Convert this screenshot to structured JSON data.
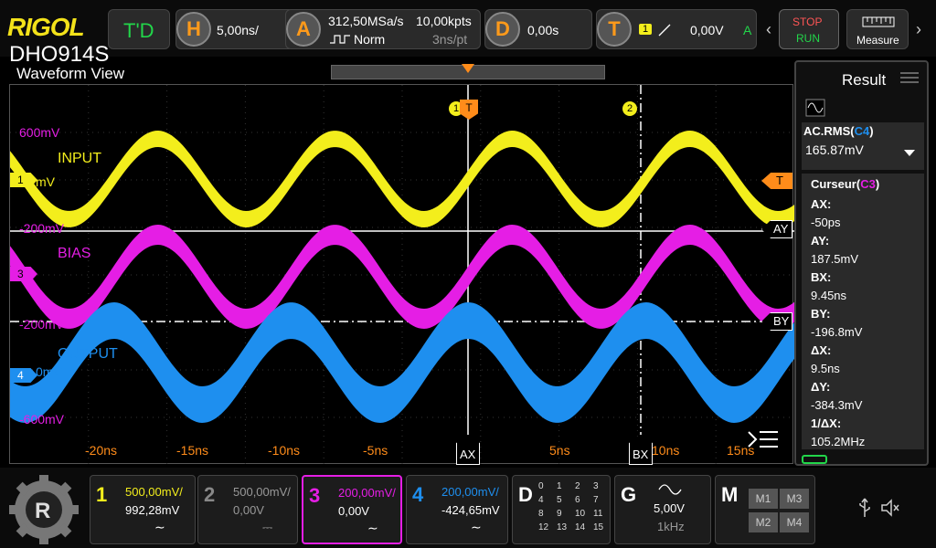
{
  "header": {
    "logo": "RIGOL",
    "model": "DHO914S",
    "td": "T'D",
    "h_letter": "H",
    "timebase": "5,00ns/",
    "a_letter": "A",
    "sample_rate": "312,50MSa/s",
    "memory_depth": "10,00kpts",
    "acq_mode": "Norm",
    "points_time": "3ns/pt",
    "d_letter": "D",
    "delay": "0,00s",
    "t_letter": "T",
    "trig_channel": "1",
    "trig_level": "0,00V",
    "trig_mode": "A",
    "stop_label": "STOP",
    "run_label": "RUN",
    "measure_label": "Measure"
  },
  "view": {
    "title": "Waveform View"
  },
  "screen": {
    "labels": {
      "v600": "600mV",
      "c1off": "mV",
      "v200": "-200mV",
      "c3off": "-200mV",
      "c4off": "0mV",
      "vm600": "-600mV",
      "input": "INPUT",
      "bias": "BIAS",
      "output": "OUTPUT"
    },
    "markers": {
      "ch1": "1",
      "ch3": "3",
      "ch4": "4",
      "trig": "T",
      "ay": "AY",
      "by": "BY",
      "ax": "AX",
      "bx": "BX",
      "mk1": "1",
      "mk2": "2"
    },
    "xticks": [
      "-20ns",
      "-15ns",
      "-10ns",
      "-5ns",
      "5ns",
      "10ns",
      "15ns"
    ]
  },
  "result": {
    "title": "Result",
    "meas_name": "AC.RMS(",
    "meas_src": "C4",
    "meas_close": ")",
    "meas_value": "165.87mV",
    "cursor_title": "Curseur(",
    "cursor_src": "C3",
    "cursor_close": ")",
    "items": [
      {
        "k": "AX:",
        "v": "-50ps"
      },
      {
        "k": "AY:",
        "v": "187.5mV"
      },
      {
        "k": "BX:",
        "v": "9.45ns"
      },
      {
        "k": "BY:",
        "v": "-196.8mV"
      },
      {
        "k": "ΔX:",
        "v": "9.5ns"
      },
      {
        "k": "ΔY:",
        "v": "-384.3mV"
      },
      {
        "k": "1/ΔX:",
        "v": "105.2MHz"
      }
    ]
  },
  "channels": [
    {
      "num": "1",
      "scale": "500,00mV/",
      "offset": "992,28mV",
      "coupling": "∼",
      "color": "#f3ee1c"
    },
    {
      "num": "2",
      "scale": "500,00mV/",
      "offset": "0,00V",
      "coupling": "⎓",
      "color": "#888888"
    },
    {
      "num": "3",
      "scale": "200,00mV/",
      "offset": "0,00V",
      "coupling": "∼",
      "color": "#e51ee5"
    },
    {
      "num": "4",
      "scale": "200,00mV/",
      "offset": "-424,65mV",
      "coupling": "∼",
      "color": "#1e8fef"
    }
  ],
  "digital": {
    "letter": "D",
    "rows": [
      [
        "0",
        "1",
        "2",
        "3"
      ],
      [
        "4",
        "5",
        "6",
        "7"
      ],
      [
        "8",
        "9",
        "10",
        "11"
      ],
      [
        "12",
        "13",
        "14",
        "15"
      ]
    ]
  },
  "generator": {
    "letter": "G",
    "amp": "5,00V",
    "freq": "1kHz"
  },
  "math": {
    "letter": "M",
    "items": [
      "M1",
      "M3",
      "M2",
      "M4"
    ]
  },
  "colors": {
    "ch1": "#f3ee1c",
    "ch3": "#e51ee5",
    "ch4": "#1e8fef",
    "trigger": "#ff8c1a",
    "bg": "#000000"
  }
}
